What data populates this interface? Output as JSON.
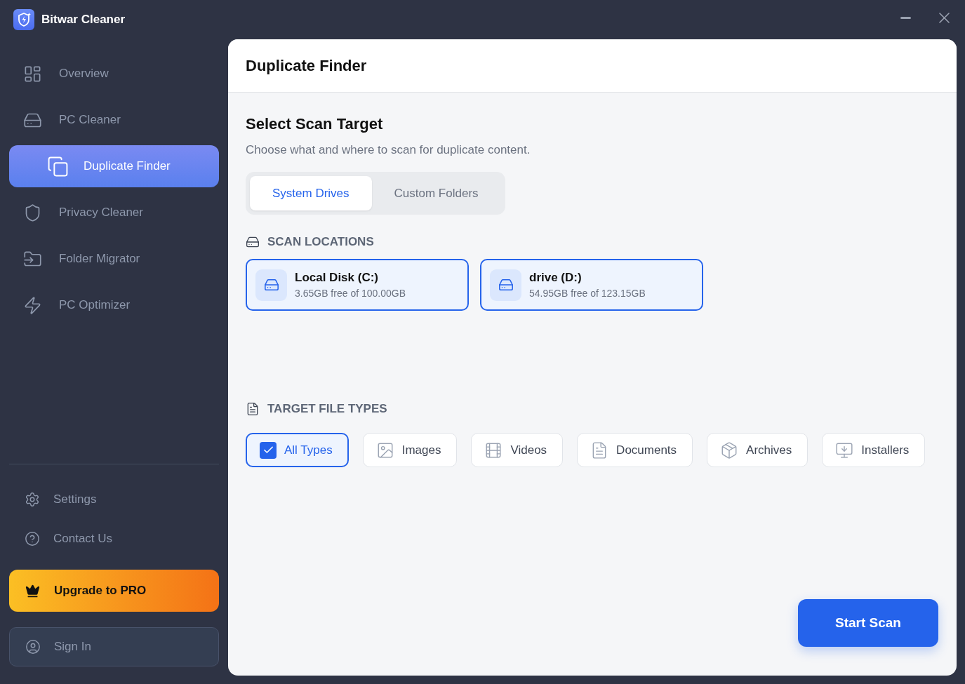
{
  "window": {
    "title": "Bitwar Cleaner"
  },
  "sidebar": {
    "items": [
      {
        "label": "Overview",
        "selected": false
      },
      {
        "label": "PC Cleaner",
        "selected": false
      },
      {
        "label": "Duplicate Finder",
        "selected": true
      },
      {
        "label": "Privacy Cleaner",
        "selected": false
      },
      {
        "label": "Folder Migrator",
        "selected": false
      },
      {
        "label": "PC Optimizer",
        "selected": false
      }
    ],
    "footer_items": [
      {
        "label": "Settings"
      },
      {
        "label": "Contact Us"
      }
    ],
    "upgrade_button": {
      "label": "Upgrade to PRO"
    },
    "sign_in_button": {
      "label": "Sign In"
    }
  },
  "main": {
    "title": "Duplicate Finder",
    "section": {
      "title": "Select Scan Target",
      "description": "Choose what and where to scan for duplicate content."
    },
    "tabs": [
      {
        "label": "System Drives",
        "selected": true
      },
      {
        "label": "Custom Folders",
        "selected": false
      }
    ],
    "scan_locations": {
      "heading": "SCAN LOCATIONS",
      "drives": [
        {
          "name": "Local Disk (C:)",
          "detail": "3.65GB free of 100.00GB",
          "selected": true
        },
        {
          "name": "drive (D:)",
          "detail": "54.95GB free of 123.15GB",
          "selected": true
        }
      ]
    },
    "file_types": {
      "heading": "TARGET FILE TYPES",
      "items": [
        {
          "label": "All Types",
          "kind": "checkbox",
          "selected": true
        },
        {
          "label": "Images",
          "kind": "icon",
          "selected": false
        },
        {
          "label": "Videos",
          "kind": "icon",
          "selected": false
        },
        {
          "label": "Documents",
          "kind": "icon",
          "selected": false
        },
        {
          "label": "Archives",
          "kind": "icon",
          "selected": false
        },
        {
          "label": "Installers",
          "kind": "icon",
          "selected": false
        }
      ]
    },
    "start_button": {
      "label": "Start Scan"
    }
  }
}
